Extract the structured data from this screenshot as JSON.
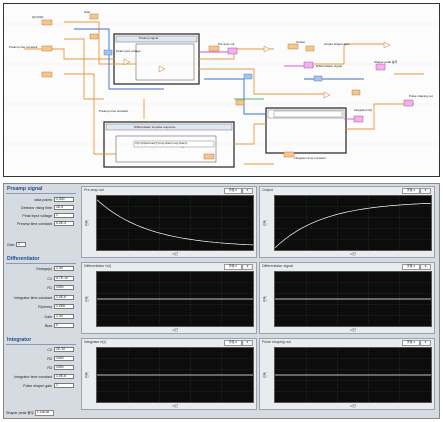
{
  "block_diagram": {
    "labels": [
      {
        "id": "q",
        "text": "Q(C)(W)"
      },
      {
        "id": "start",
        "text": "Start"
      },
      {
        "id": "preamp_rise_const",
        "text": "Preamp rise constant"
      },
      {
        "id": "preamp_signal",
        "text": "Preamp signal"
      },
      {
        "id": "peak_input_voltage",
        "text": "Peak input voltage"
      },
      {
        "id": "preamp_time_constant",
        "text": "Preamp time constant"
      },
      {
        "id": "differentiator_impulse_response",
        "text": "Differentiator impulse response"
      },
      {
        "id": "pre_amp_out",
        "text": "Pre amp out"
      },
      {
        "id": "output",
        "text": "Output"
      },
      {
        "id": "differentiator_signal",
        "text": "Differentiator signal"
      },
      {
        "id": "shaper_peak",
        "text": "Shaper peak 봉우"
      },
      {
        "id": "pulse_shaping_out",
        "text": "Pulse shaping out"
      },
      {
        "id": "integrator_hxt",
        "text": "Integrator h(t)"
      },
      {
        "id": "integrator_time_constant",
        "text": "Integrator time constant"
      },
      {
        "id": "output_shaper_gain",
        "text": "Output shaper gain"
      },
      {
        "id": "formula",
        "text": "V(t)=(1/(tau2-tau1))*(exp(-t/tau2)-exp(-t/tau1))"
      }
    ]
  },
  "front_panel": {
    "preamp": {
      "title": "Preamp signal",
      "fields": [
        {
          "label": "data points",
          "value": "1,000"
        },
        {
          "label": "Detector rising time",
          "value": "1E-9"
        },
        {
          "label": "Peak input voltage",
          "value": "1"
        },
        {
          "label": "Preamp time constant",
          "value": "5.0E-4"
        }
      ]
    },
    "gain_label": "Gain",
    "gain_value": "1",
    "differentiator": {
      "title": "Differentiator",
      "fields": [
        {
          "label": "Omega(s)",
          "value": "1.00"
        },
        {
          "label": "C1",
          "value": "4.7E-10"
        },
        {
          "label": "R1",
          "value": "1000"
        },
        {
          "label": "Integrator time constant",
          "value": "1.0E-6"
        },
        {
          "label": "R(ohms)",
          "value": "1.0E6"
        },
        {
          "label": "Gain",
          "value": "1.00"
        },
        {
          "label": "Bias",
          "value": "0"
        }
      ]
    },
    "integrator": {
      "title": "Integrator",
      "fields": [
        {
          "label": "C2",
          "value": "1E-10"
        },
        {
          "label": "R2",
          "value": "1000"
        },
        {
          "label": "R3",
          "value": "1000"
        },
        {
          "label": "Integrator time constant",
          "value": "1.0E-6"
        },
        {
          "label": "Pulse shaper gain",
          "value": "1"
        }
      ]
    },
    "status": {
      "label": "Shaper peak 봉우",
      "value": "1.13E-06"
    }
  },
  "charts": [
    {
      "id": "preamp_out",
      "title": "Pre amp out",
      "legend": "플롯 0",
      "ylabel": "진폭",
      "xlabel": "시간",
      "shape": "decay"
    },
    {
      "id": "output",
      "title": "Output",
      "legend": "플롯 0",
      "ylabel": "진폭",
      "xlabel": "시간",
      "shape": "rise"
    },
    {
      "id": "diff_hxt",
      "title": "Differentiator h(t)",
      "legend": "플롯 0",
      "ylabel": "진폭",
      "xlabel": "시간",
      "shape": "flat"
    },
    {
      "id": "diff_signal",
      "title": "Differentiator signal",
      "legend": "플롯 0",
      "ylabel": "진폭",
      "xlabel": "시간",
      "shape": "flat"
    },
    {
      "id": "integrator_hxt",
      "title": "Integrator h(t)",
      "legend": "플롯 0",
      "ylabel": "진폭",
      "xlabel": "시간",
      "shape": "flat"
    },
    {
      "id": "pulse_shaping",
      "title": "Pulse shaping out",
      "legend": "플롯 0",
      "ylabel": "진폭",
      "xlabel": "시간",
      "shape": "flat"
    }
  ],
  "colors": {
    "plot_bg": "#0c0c0c",
    "grid": "#2c5a1f",
    "curve": "#ffffff",
    "wire_orange": "#e59a3a",
    "wire_blue": "#3a6fc8",
    "wire_pink": "#d25ac8",
    "wire_green": "#2a9a3a"
  }
}
